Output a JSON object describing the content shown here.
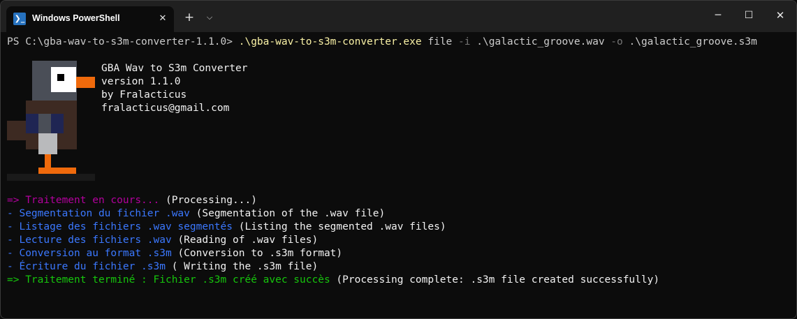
{
  "window": {
    "tab_title": "Windows PowerShell",
    "tab_icon": "powershell-icon",
    "tab_icon_glyph": "❯_",
    "close_tab_glyph": "✕",
    "new_tab_glyph": "+",
    "dropdown_glyph": "⌵",
    "minimize_glyph": "─",
    "maximize_glyph": "☐",
    "close_glyph": "✕"
  },
  "terminal": {
    "prompt": "PS C:\\gba-wav-to-s3m-converter-1.1.0> ",
    "command_exe": ".\\gba-wav-to-s3m-converter.exe",
    "command_arg1": " file ",
    "flag_i": "-i",
    "path_in": " .\\galactic_groove.wav ",
    "flag_o": "-o",
    "path_out": " .\\galactic_groove.s3m",
    "info": {
      "name": "GBA Wav to S3m Converter",
      "version": "version 1.1.0",
      "author": "by Fralacticus",
      "email": "fralacticus@gmail.com"
    },
    "output": [
      {
        "lead": "=> Traitement en cours... ",
        "note": "(Processing...)",
        "color": "magenta"
      },
      {
        "lead": "- Segmentation du fichier .wav ",
        "note": "(Segmentation of the .wav file)",
        "color": "blue"
      },
      {
        "lead": "- Listage des fichiers .wav segmentés ",
        "note": "(Listing the segmented .wav files)",
        "color": "blue"
      },
      {
        "lead": "- Lecture des fichiers .wav ",
        "note": "(Reading of .wav files)",
        "color": "blue"
      },
      {
        "lead": "- Conversion au format .s3m ",
        "note": "(Conversion to .s3m format)",
        "color": "blue"
      },
      {
        "lead": "- Écriture du fichier .s3m ",
        "note": "( Writing the .s3m file)",
        "color": "blue"
      },
      {
        "lead": "=> Traitement terminé : Fichier .s3m créé avec succès ",
        "note": "(Processing complete: .s3m file created successfully)",
        "color": "green"
      }
    ]
  },
  "colors": {
    "background": "#0c0c0c",
    "titlebar": "#202020",
    "magenta": "#b4009e",
    "blue": "#3b78ff",
    "green": "#16c60c",
    "yellow": "#f9f1a5"
  }
}
